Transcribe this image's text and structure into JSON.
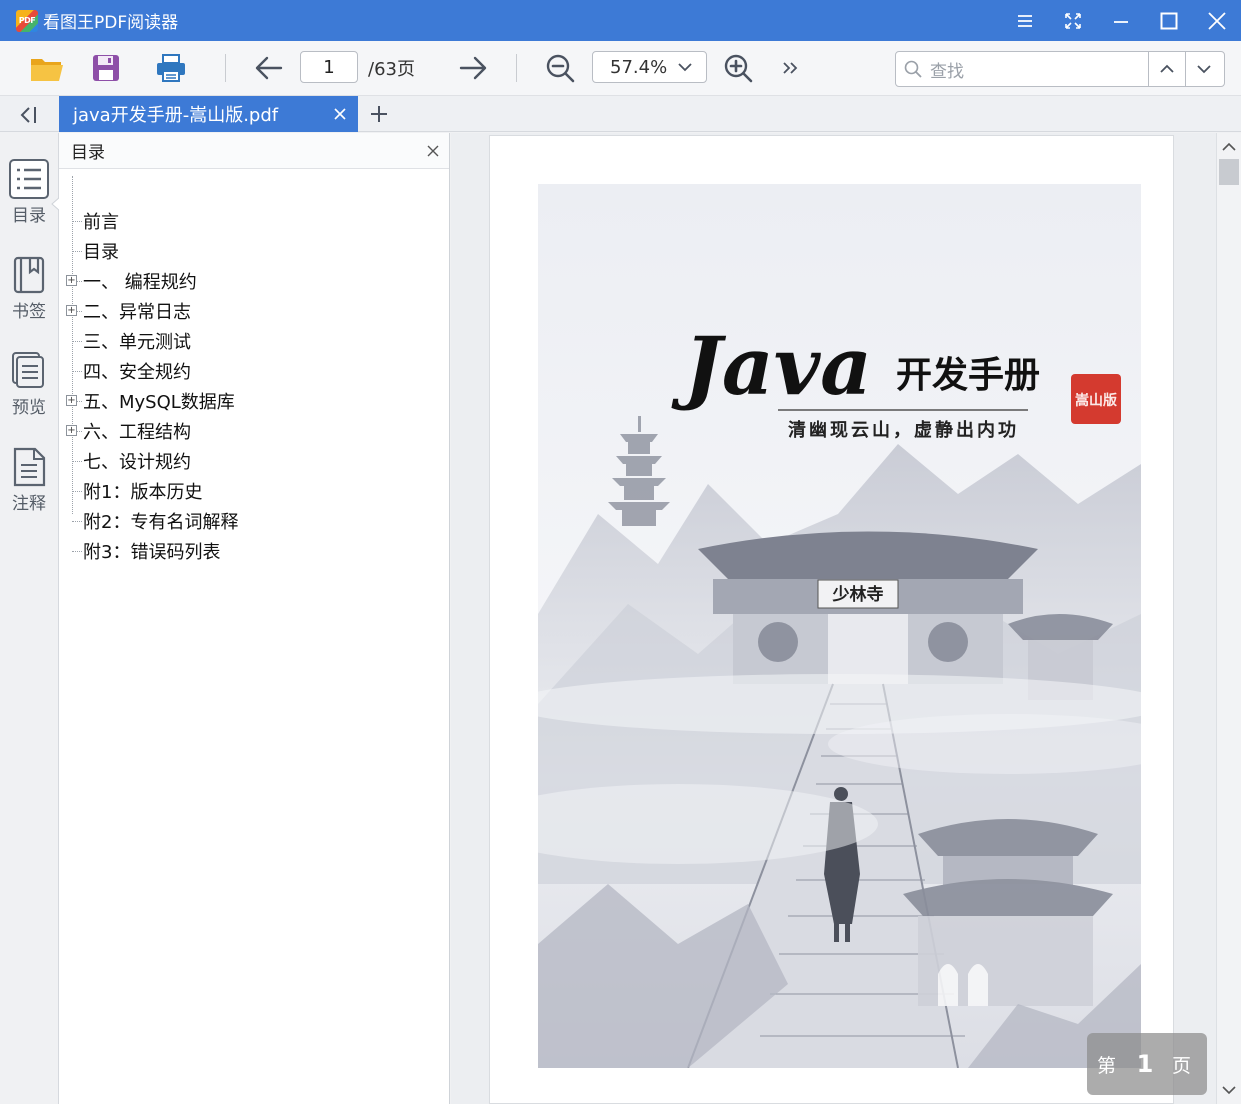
{
  "titlebar": {
    "logo_text": "PDF",
    "title": "看图王PDF阅读器"
  },
  "toolbar": {
    "page_current": "1",
    "page_total": "/63页",
    "zoom": "57.4%",
    "search_placeholder": "查找"
  },
  "tabs": [
    {
      "label": "java开发手册-嵩山版.pdf",
      "active": true
    }
  ],
  "rail": {
    "items": [
      {
        "label": "目录",
        "icon": "list-icon",
        "active": true
      },
      {
        "label": "书签",
        "icon": "bookmark-icon",
        "active": false
      },
      {
        "label": "预览",
        "icon": "pages-preview-icon",
        "active": false
      },
      {
        "label": "注释",
        "icon": "note-icon",
        "active": false
      }
    ]
  },
  "toc": {
    "title": "目录",
    "items": [
      {
        "label": "前言",
        "expandable": false
      },
      {
        "label": "目录",
        "expandable": false
      },
      {
        "label": "一、 编程规约",
        "expandable": true
      },
      {
        "label": "二、异常日志",
        "expandable": true
      },
      {
        "label": "三、单元测试",
        "expandable": false
      },
      {
        "label": "四、安全规约",
        "expandable": false
      },
      {
        "label": "五、MySQL数据库",
        "expandable": true
      },
      {
        "label": "六、工程结构",
        "expandable": true
      },
      {
        "label": "七、设计规约",
        "expandable": false
      },
      {
        "label": "附1：版本历史",
        "expandable": false
      },
      {
        "label": "附2：专有名词解释",
        "expandable": false
      },
      {
        "label": "附3：错误码列表",
        "expandable": false
      }
    ]
  },
  "cover": {
    "title": "Java",
    "title_cn": "开发手册",
    "seal": "嵩山版",
    "subtitle": "清幽现云山，虚静出内功",
    "gate_plaque": "少林寺"
  },
  "page_badge": {
    "prefix": "第",
    "number": "1",
    "suffix": "页"
  },
  "colors": {
    "accent": "#3d7ad6",
    "seal_red": "#d43a2f"
  }
}
